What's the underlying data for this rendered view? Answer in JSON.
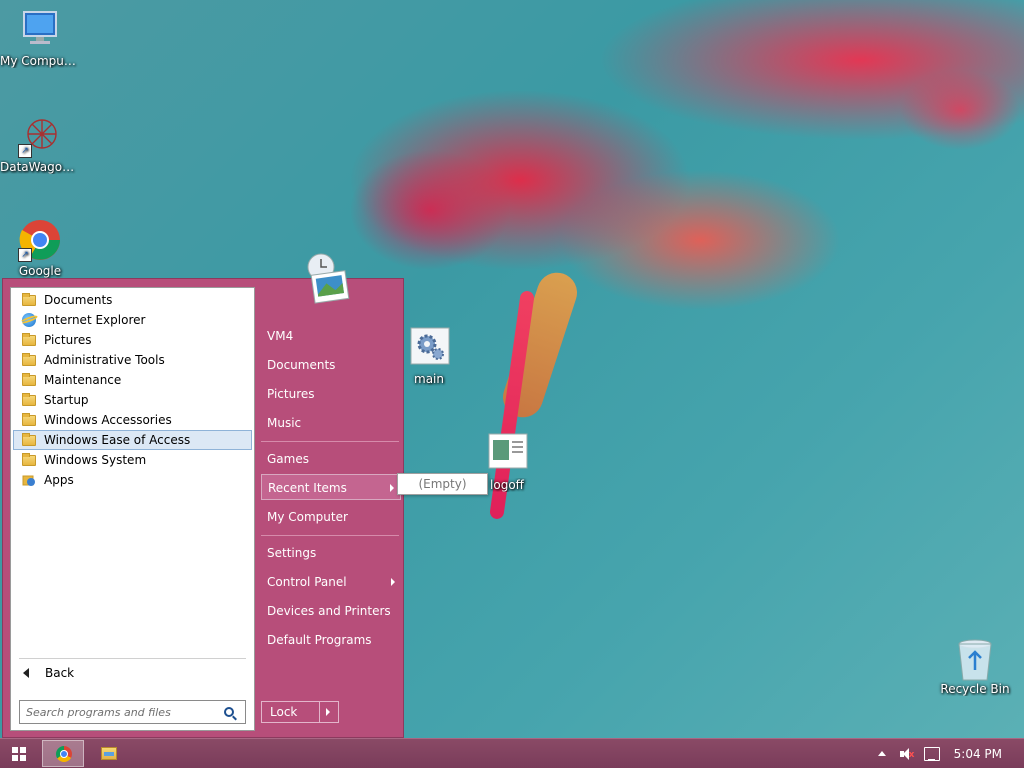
{
  "desktop": {
    "icons": [
      {
        "label": "My Computer"
      },
      {
        "label": "DataWagon..."
      },
      {
        "label": "Google"
      },
      {
        "label": "main"
      },
      {
        "label": "logoff"
      },
      {
        "label": "Recycle Bin"
      }
    ]
  },
  "start_menu": {
    "programs": [
      {
        "label": "Documents",
        "icon": "folder-icon"
      },
      {
        "label": "Internet Explorer",
        "icon": "ie-icon"
      },
      {
        "label": "Pictures",
        "icon": "folder-icon"
      },
      {
        "label": "Administrative Tools",
        "icon": "folder-icon"
      },
      {
        "label": "Maintenance",
        "icon": "folder-icon"
      },
      {
        "label": "Startup",
        "icon": "folder-icon"
      },
      {
        "label": "Windows Accessories",
        "icon": "folder-icon"
      },
      {
        "label": "Windows Ease of Access",
        "icon": "folder-icon",
        "selected": true
      },
      {
        "label": "Windows System",
        "icon": "folder-icon"
      },
      {
        "label": "Apps",
        "icon": "apps-icon"
      }
    ],
    "back_label": "Back",
    "search_placeholder": "Search programs and files",
    "right_items": [
      {
        "label": "VM4"
      },
      {
        "label": "Documents"
      },
      {
        "label": "Pictures"
      },
      {
        "label": "Music"
      },
      {
        "label": "Games"
      },
      {
        "label": "Recent Items",
        "has_submenu": true,
        "highlighted": true
      },
      {
        "label": "My Computer"
      },
      {
        "label": "Settings"
      },
      {
        "label": "Control Panel",
        "has_submenu": true
      },
      {
        "label": "Devices and Printers"
      },
      {
        "label": "Default Programs"
      }
    ],
    "lock_label": "Lock",
    "recent_submenu": {
      "label": "(Empty)"
    }
  },
  "taskbar": {
    "clock": "5:04 PM"
  },
  "colors": {
    "start_menu_bg": "#b74e7a",
    "taskbar_bg": "#7a3c5a",
    "selection_bg": "#dce8f5"
  }
}
